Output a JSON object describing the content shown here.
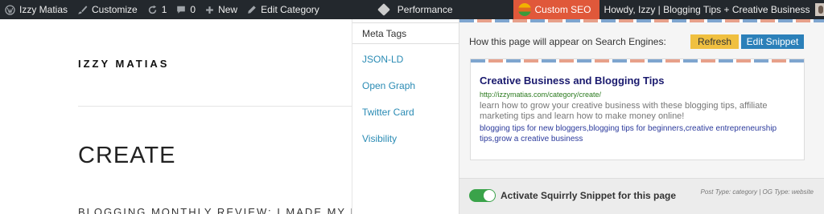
{
  "adminbar": {
    "site_name": "Izzy Matias",
    "customize": "Customize",
    "updates_count": "1",
    "comments_count": "0",
    "new_label": "New",
    "edit_category": "Edit Category",
    "performance": "Performance",
    "custom_seo": "Custom SEO",
    "howdy": "Howdy, Izzy | Blogging Tips + Creative Business",
    "icons": [
      "wordpress-icon",
      "brush-icon",
      "refresh-icon",
      "comment-icon",
      "plus-icon",
      "pencil-icon",
      "yoast-icon",
      "status-dot-icon",
      "chat-icon",
      "seo-logo-icon",
      "avatar"
    ]
  },
  "page": {
    "site_logo": "IZZY MATIAS",
    "title": "CREATE",
    "post_title": "BLOGGING MONTHLY REVIEW: I MADE MY FIR"
  },
  "seo": {
    "tabs": [
      {
        "label": "Meta Tags",
        "active": true
      },
      {
        "label": "JSON-LD"
      },
      {
        "label": "Open Graph"
      },
      {
        "label": "Twitter Card"
      },
      {
        "label": "Visibility"
      }
    ],
    "appear_label": "How this page will appear on Search Engines:",
    "refresh_label": "Refresh",
    "edit_label": "Edit Snippet",
    "snippet": {
      "title": "Creative Business and Blogging Tips",
      "url": "http://izzymatias.com/category/create/",
      "description": "learn how to grow your creative business with these blogging tips, affiliate marketing tips and learn how to make money online!",
      "keywords": "blogging tips for new bloggers,blogging tips for beginners,creative entrepreneurship tips,grow a creative business"
    },
    "toggle_label": "Activate Squirrly Snippet for this page",
    "toggle_on": true,
    "post_type": "Post Type: category | OG Type: website"
  },
  "colors": {
    "adminbar_bg": "#23282d",
    "seo_accent": "#e0583a",
    "link_blue": "#2a8bb4",
    "refresh_yellow": "#f0c040",
    "edit_blue": "#2b80b9",
    "toggle_green": "#3aa34a"
  }
}
